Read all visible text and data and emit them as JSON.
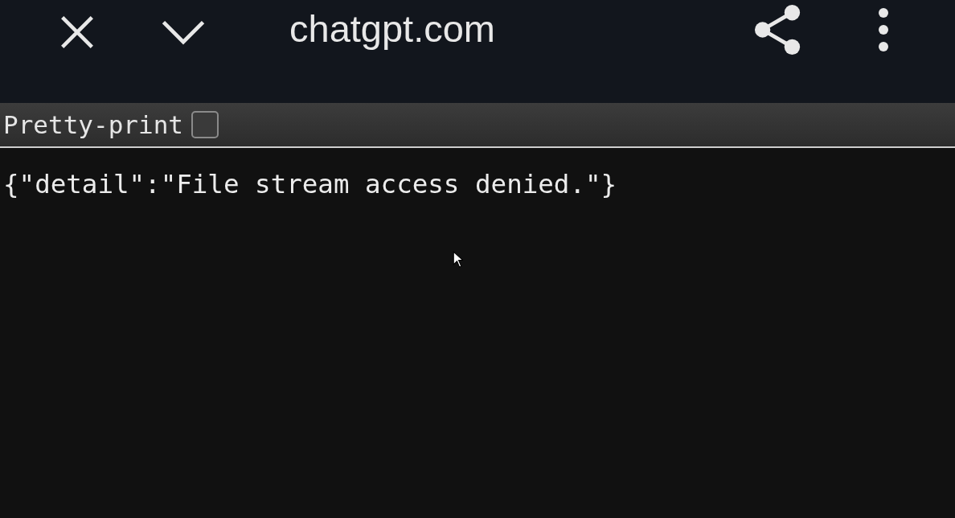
{
  "toolbar": {
    "url": "chatgpt.com"
  },
  "pretty_print": {
    "label": "Pretty-print",
    "checked": false
  },
  "content": "{\"detail\":\"File stream access denied.\"}"
}
